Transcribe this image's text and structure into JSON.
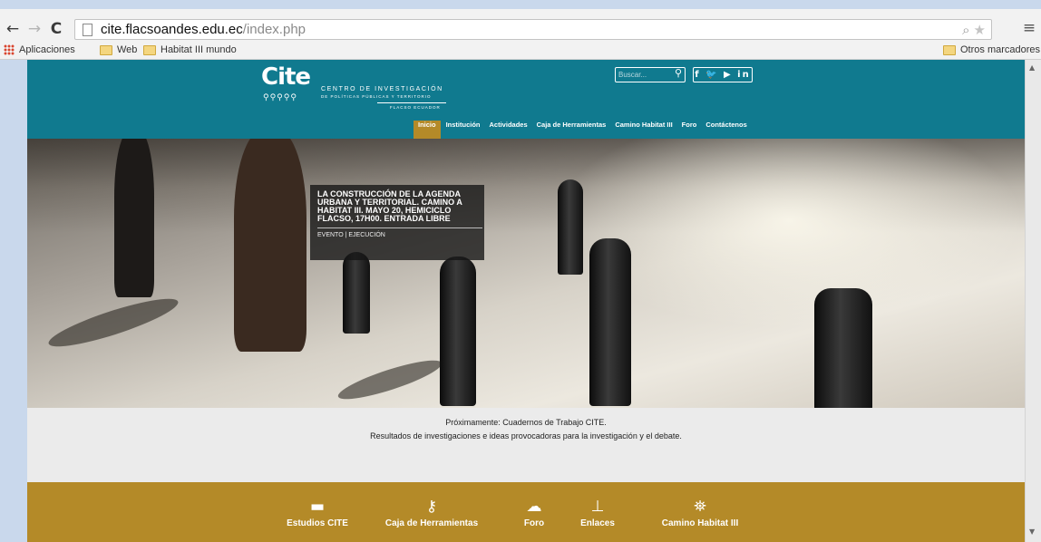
{
  "browser": {
    "back": "←",
    "forward": "→",
    "reload": "C",
    "url_host": "cite.flacsoandes.edu.ec",
    "url_path": "/index.php",
    "zoom_icon": "⌕",
    "star_icon": "★",
    "menu_icon": "≡",
    "bookmarks": {
      "apps": "Aplicaciones",
      "web": "Web",
      "habitat": "Habitat III mundo",
      "other": "Otros marcadores"
    }
  },
  "site": {
    "logo": {
      "word": "Cite",
      "line1": "CENTRO DE INVESTIGACIÓN",
      "line2": "DE POLÍTICAS PÚBLICAS Y TERRITORIO",
      "line3": "FLACSO ECUADOR"
    },
    "search_placeholder": "Buscar...",
    "search_icon": "⚲",
    "social": "f  🐦  ▶  in",
    "menu": [
      "Inicio",
      "Institución",
      "Actividades",
      "Caja de Herramientas",
      "Camino Habitat III",
      "Foro",
      "Contáctenos"
    ],
    "hero": {
      "title": "LA CONSTRUCCIÓN DE LA AGENDA URBANA Y TERRITORIAL. CAMINO A HABITAT III. MAYO 20, HEMICICLO FLACSO, 17H00. ENTRADA LIBRE",
      "meta": "EVENTO | EJECUCIÓN"
    },
    "announcement": {
      "line1": "Próximamente: Cuadernos de Trabajo CITE.",
      "line2": "Resultados de investigaciones e ideas provocadoras para la investigación y el debate."
    },
    "footer_links": [
      {
        "label": "Estudios CITE",
        "icon": "▬"
      },
      {
        "label": "Caja de Herramientas",
        "icon": "⚷"
      },
      {
        "label": "Foro",
        "icon": "☁"
      },
      {
        "label": "Enlaces",
        "icon": "⊥"
      },
      {
        "label": "Camino Habitat III",
        "icon": "⛯"
      }
    ]
  },
  "colors": {
    "header": "#107a8f",
    "accent": "#b48a28",
    "announce_bg": "#ebebeb"
  }
}
